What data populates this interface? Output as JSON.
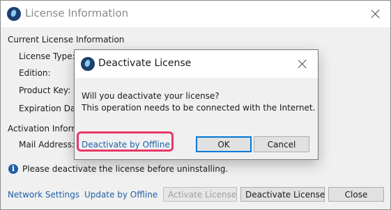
{
  "window": {
    "title": "License Information",
    "icon": "app-logo-icon",
    "close_icon": "close-icon"
  },
  "current_license": {
    "heading": "Current License Information",
    "license_type_label": "License Type:",
    "edition_label": "Edition:",
    "product_key_label": "Product Key:",
    "expiration_label": "Expiration Da"
  },
  "activation": {
    "heading": "Activation Inform",
    "mail_label": "Mail Address:"
  },
  "notice": {
    "icon": "info-icon",
    "text": "Please deactivate the license before uninstalling."
  },
  "footer": {
    "network_settings": "Network Settings",
    "update_offline": "Update by Offline",
    "activate_label": "Activate License",
    "deactivate_label": "Deactivate License",
    "close_label": "Close"
  },
  "dialog": {
    "title": "Deactivate License",
    "message_line1": "Will you deactivate your license?",
    "message_line2": "This operation needs to be connected with the Internet.",
    "offline_link": "Deactivate by Offline",
    "ok_label": "OK",
    "cancel_label": "Cancel",
    "highlight_color": "#e8386a"
  }
}
